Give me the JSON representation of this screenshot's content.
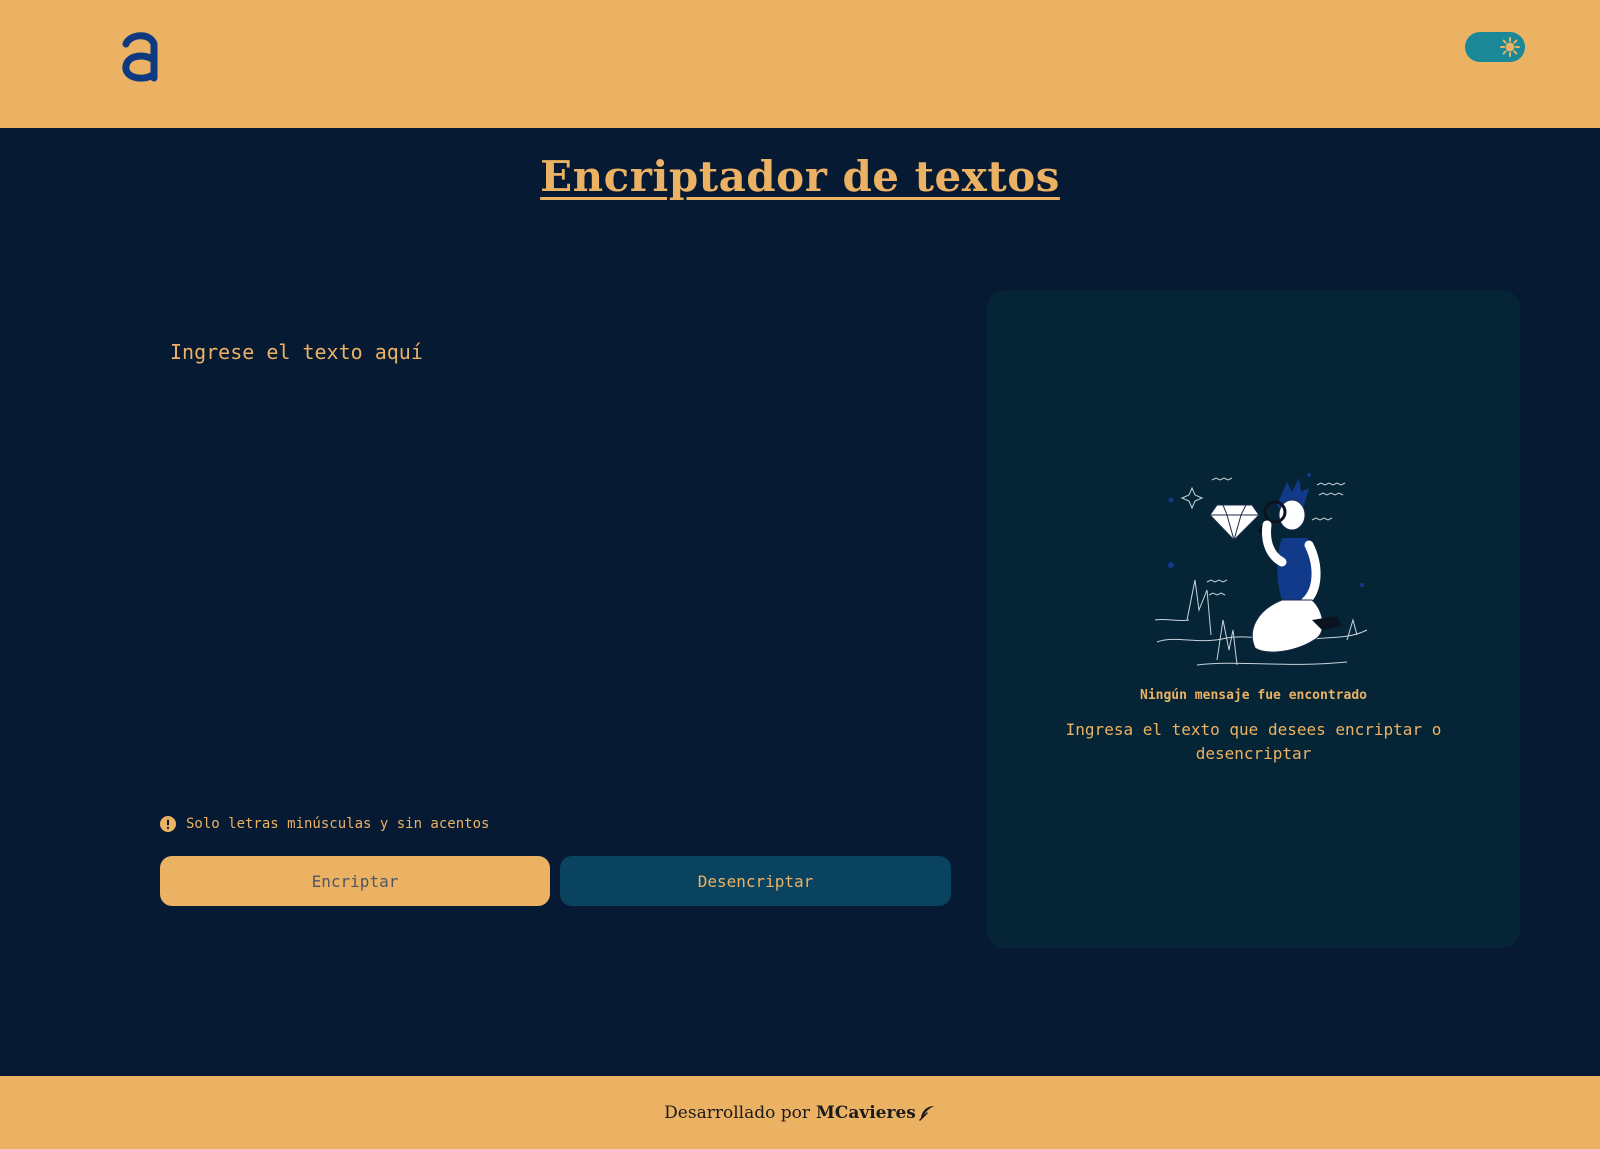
{
  "header": {
    "logo_icon": "a-logo-icon",
    "theme_toggle": {
      "icon": "sun-icon",
      "accent_color": "#1a8896"
    }
  },
  "main": {
    "title": "Encriptador de textos",
    "input": {
      "placeholder": "Ingrese el texto aquí",
      "value": ""
    },
    "warning": {
      "icon": "alert-circle-icon",
      "text": "Solo letras minúsculas y sin acentos"
    },
    "buttons": {
      "encrypt_label": "Encriptar",
      "decrypt_label": "Desencriptar"
    }
  },
  "output": {
    "illustration": "person-with-magnifier-illustration",
    "empty_title": "Ningún mensaje fue encontrado",
    "empty_description": "Ingresa el texto que desees encriptar o desencriptar"
  },
  "footer": {
    "prefix": "Desarrollado por",
    "author": "MCavieres",
    "icon": "feather-icon"
  },
  "colors": {
    "background": "#061a33",
    "accent": "#ecb263",
    "panel": "#052536",
    "secondary_button": "#0a4360"
  }
}
